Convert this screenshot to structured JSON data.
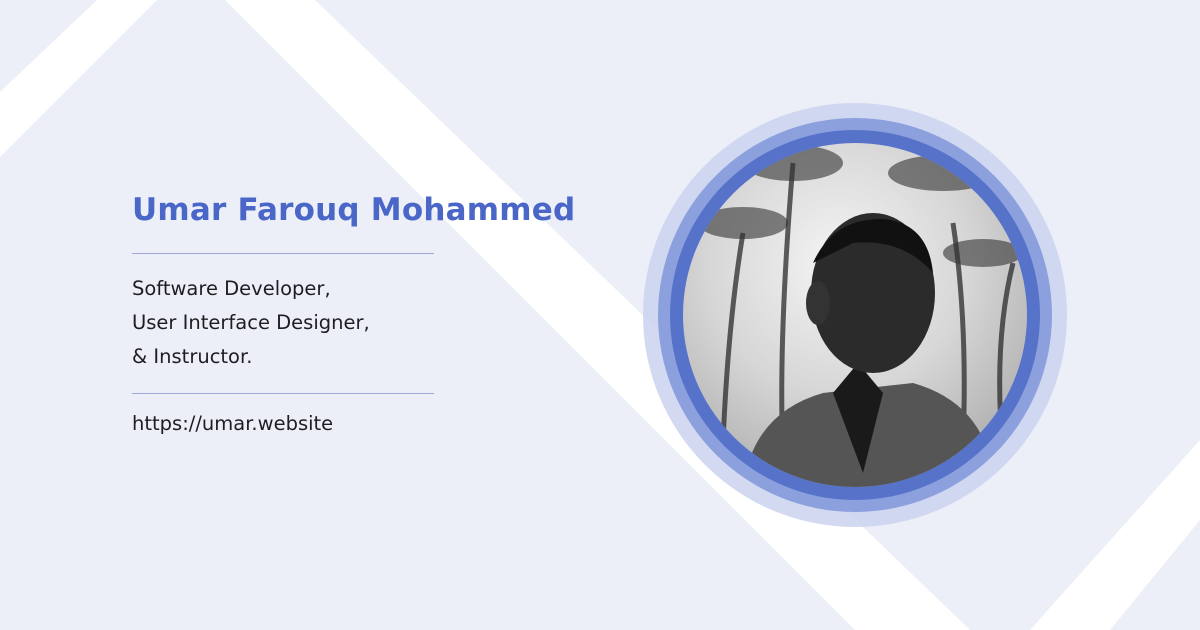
{
  "profile": {
    "name": "Umar Farouq Mohammed",
    "roles": [
      "Software Developer,",
      "User Interface Designer,",
      "& Instructor."
    ],
    "website": "https://umar.website",
    "photo_icon": "profile-photo"
  },
  "colors": {
    "accent": "#4a67c8",
    "background": "#eceff8",
    "ring_outer": "#cdd5ef",
    "ring_middle": "#8ba0dd",
    "ring_inner": "#5672c9"
  }
}
